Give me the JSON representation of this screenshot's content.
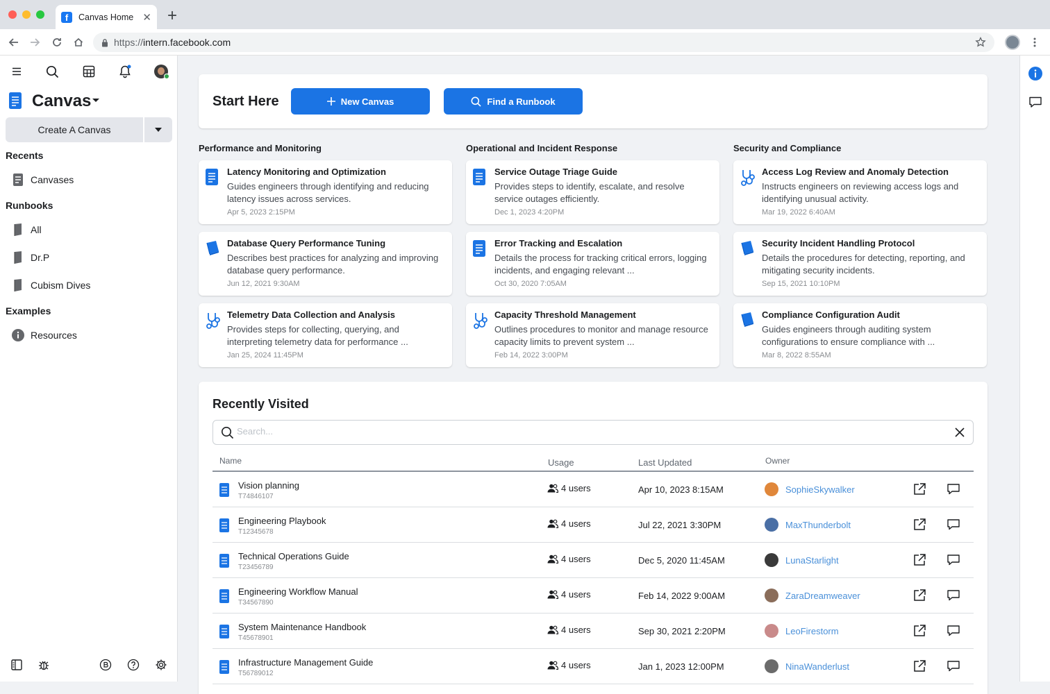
{
  "browser": {
    "tab_title": "Canvas Home",
    "url_scheme": "https://",
    "url_host": "intern.facebook.com"
  },
  "sidebar": {
    "title": "Canvas",
    "create_button": "Create A Canvas",
    "sections": {
      "recents": "Recents",
      "runbooks": "Runbooks",
      "examples": "Examples"
    },
    "recents_items": [
      "Canvases"
    ],
    "runbook_items": [
      "All",
      "Dr.P",
      "Cubism Dives"
    ],
    "example_items": [
      "Resources"
    ]
  },
  "start_here": {
    "title": "Start Here",
    "new_canvas": "New Canvas",
    "find_runbook": "Find a Runbook"
  },
  "columns": [
    {
      "title": "Performance and Monitoring",
      "cards": [
        {
          "icon": "document-icon",
          "title": "Latency Monitoring and Optimization",
          "desc": "Guides engineers through identifying and reducing latency issues across services.",
          "date": "Apr 5, 2023 2:15PM"
        },
        {
          "icon": "book-icon",
          "title": "Database Query Performance Tuning",
          "desc": "Describes best practices for analyzing and improving database query performance.",
          "date": "Jun 12, 2021 9:30AM"
        },
        {
          "icon": "stethoscope-icon",
          "title": "Telemetry Data Collection and Analysis",
          "desc": "Provides steps for collecting, querying, and interpreting telemetry data for performance ...",
          "date": "Jan 25, 2024 11:45PM"
        }
      ]
    },
    {
      "title": "Operational and Incident Response",
      "cards": [
        {
          "icon": "document-icon",
          "title": "Service Outage Triage Guide",
          "desc": "Provides steps to identify, escalate, and resolve service outages efficiently.",
          "date": "Dec 1, 2023 4:20PM"
        },
        {
          "icon": "document-icon",
          "title": "Error Tracking and Escalation",
          "desc": "Details the process for tracking critical errors, logging incidents, and engaging relevant ...",
          "date": "Oct 30, 2020 7:05AM"
        },
        {
          "icon": "stethoscope-icon",
          "title": "Capacity Threshold Management",
          "desc": "Outlines procedures to monitor and manage resource capacity limits to prevent system ...",
          "date": "Feb 14, 2022 3:00PM"
        }
      ]
    },
    {
      "title": "Security and Compliance",
      "cards": [
        {
          "icon": "stethoscope-icon",
          "title": "Access Log Review and Anomaly Detection",
          "desc": "Instructs engineers on reviewing access logs and identifying unusual activity.",
          "date": "Mar 19, 2022 6:40AM"
        },
        {
          "icon": "book-icon",
          "title": "Security Incident Handling Protocol",
          "desc": "Details the procedures for detecting, reporting, and mitigating security incidents.",
          "date": "Sep 15, 2021 10:10PM"
        },
        {
          "icon": "book-icon",
          "title": "Compliance Configuration Audit",
          "desc": "Guides engineers through auditing system configurations to ensure compliance with ...",
          "date": "Mar 8, 2022 8:55AM"
        }
      ]
    }
  ],
  "recently_visited": {
    "title": "Recently Visited",
    "search_placeholder": "Search...",
    "headers": {
      "name": "Name",
      "usage": "Usage",
      "updated": "Last Updated",
      "owner": "Owner"
    },
    "rows": [
      {
        "name": "Vision planning",
        "id": "T74846107",
        "usage": "4 users",
        "updated": "Apr 10, 2023 8:15AM",
        "owner": "SophieSkywalker",
        "avatar_color": "#e0873a"
      },
      {
        "name": "Engineering Playbook",
        "id": "T12345678",
        "usage": "4 users",
        "updated": "Jul 22, 2021 3:30PM",
        "owner": "MaxThunderbolt",
        "avatar_color": "#4a6fa5"
      },
      {
        "name": "Technical Operations Guide",
        "id": "T23456789",
        "usage": "4 users",
        "updated": "Dec 5, 2020 11:45AM",
        "owner": "LunaStarlight",
        "avatar_color": "#3a3a3a"
      },
      {
        "name": "Engineering Workflow Manual",
        "id": "T34567890",
        "usage": "4 users",
        "updated": "Feb 14, 2022 9:00AM",
        "owner": "ZaraDreamweaver",
        "avatar_color": "#8a6d5a"
      },
      {
        "name": "System Maintenance Handbook",
        "id": "T45678901",
        "usage": "4 users",
        "updated": "Sep 30, 2021 2:20PM",
        "owner": "LeoFirestorm",
        "avatar_color": "#c98a8a"
      },
      {
        "name": "Infrastructure Management Guide",
        "id": "T56789012",
        "usage": "4 users",
        "updated": "Jan 1, 2023 12:00PM",
        "owner": "NinaWanderlust",
        "avatar_color": "#6b6b6b"
      }
    ]
  },
  "colors": {
    "accent": "#1b74e4",
    "link": "#4a90d9"
  }
}
